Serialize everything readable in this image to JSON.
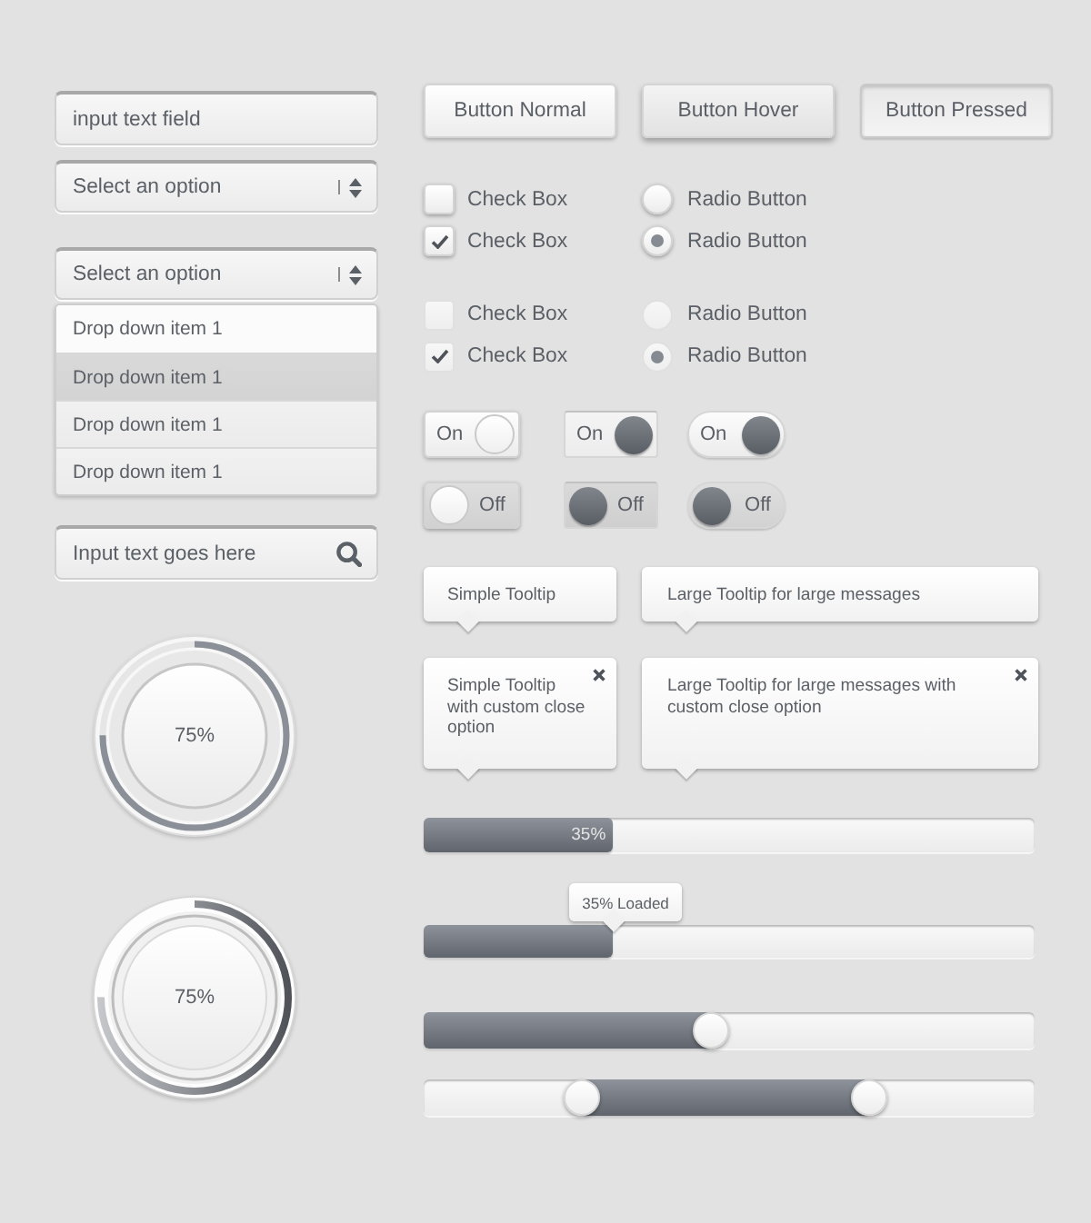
{
  "text_field": {
    "value": "input text field"
  },
  "select": {
    "value": "Select an option"
  },
  "dropdown": {
    "value": "Select an option",
    "items": [
      {
        "label": "Drop down item 1",
        "hovered": true,
        "selected": false
      },
      {
        "label": "Drop down item 1",
        "hovered": false,
        "selected": true
      },
      {
        "label": "Drop down item 1",
        "hovered": false,
        "selected": false
      },
      {
        "label": "Drop down item 1",
        "hovered": false,
        "selected": false
      }
    ]
  },
  "search": {
    "placeholder": "Input text goes here"
  },
  "progress_rings": [
    {
      "kind": "thin",
      "level": 0.75,
      "label": "75%"
    },
    {
      "kind": "shaded",
      "level": 0.75,
      "label": "75%"
    }
  ],
  "buttons": [
    {
      "label": "Button Normal",
      "hovered": false,
      "pressed": false
    },
    {
      "label": "Button Hover",
      "hovered": true,
      "pressed": false
    },
    {
      "label": "Button Pressed",
      "hovered": false,
      "pressed": true
    }
  ],
  "choice_groups": [
    {
      "kind": "raised",
      "rows": [
        {
          "checkbox": {
            "label": "Check Box",
            "checked": false
          },
          "radio": {
            "label": "Radio Button",
            "selected": false
          }
        },
        {
          "checkbox": {
            "label": "Check Box",
            "checked": true
          },
          "radio": {
            "label": "Radio Button",
            "selected": true
          }
        }
      ]
    },
    {
      "kind": "flat",
      "rows": [
        {
          "checkbox": {
            "label": "Check Box",
            "checked": false
          },
          "radio": {
            "label": "Radio Button",
            "selected": false
          }
        },
        {
          "checkbox": {
            "label": "Check Box",
            "checked": true
          },
          "radio": {
            "label": "Radio Button",
            "selected": true
          }
        }
      ]
    }
  ],
  "toggles": [
    {
      "kind": "raised",
      "label": "On",
      "on": true
    },
    {
      "kind": "inset",
      "label": "On",
      "on": true
    },
    {
      "kind": "pill",
      "label": "On",
      "on": true
    },
    {
      "kind": "raised",
      "label": "Off",
      "on": false
    },
    {
      "kind": "inset",
      "label": "Off",
      "on": false
    },
    {
      "kind": "pill",
      "label": "Off",
      "on": false
    }
  ],
  "tooltips": [
    {
      "kind": "small",
      "text": "Simple Tooltip",
      "closable": false
    },
    {
      "kind": "large",
      "text": "Large Tooltip for large messages",
      "closable": false
    },
    {
      "kind": "small",
      "text": "Simple Tooltip with custom close option",
      "closable": true
    },
    {
      "kind": "large",
      "text": "Large Tooltip for large messages with custom close option",
      "closable": true
    }
  ],
  "progress_bars": [
    {
      "kind": "inline",
      "level": 0.31,
      "label": "35%"
    },
    {
      "kind": "tooltip",
      "level": 0.31,
      "label": "35% Loaded"
    }
  ],
  "sliders": [
    {
      "kind": "single",
      "level": 0.47
    },
    {
      "kind": "range",
      "thumbs": [
        {
          "level": 0.26
        },
        {
          "level": 0.73
        }
      ]
    }
  ]
}
